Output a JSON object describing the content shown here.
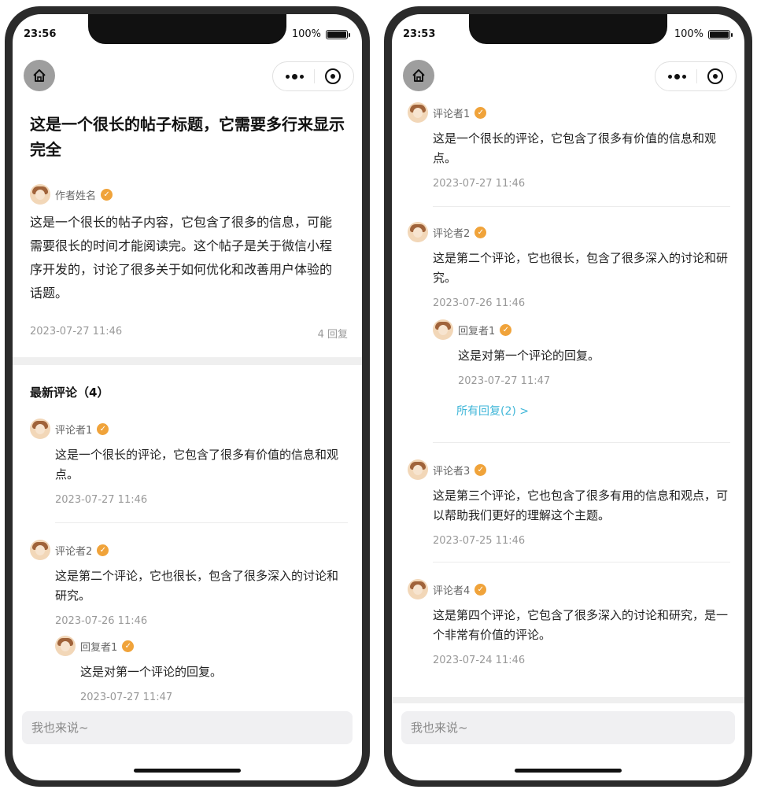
{
  "screens": {
    "left": {
      "time": "23:56",
      "battery": "100%",
      "post": {
        "title": "这是一个很长的帖子标题，它需要多行来显示完全",
        "author": "作者姓名",
        "content": "这是一个很长的帖子内容，它包含了很多的信息，可能需要很长的时间才能阅读完。这个帖子是关于微信小程序开发的，讨论了很多关于如何优化和改善用户体验的话题。",
        "date": "2023-07-27 11:46",
        "reply_count": "4 回复"
      },
      "section_title": "最新评论（4）",
      "comments": [
        {
          "name": "评论者1",
          "text": "这是一个很长的评论，它包含了很多有价值的信息和观点。",
          "time": "2023-07-27 11:46"
        },
        {
          "name": "评论者2",
          "text": "这是第二个评论，它也很长，包含了很多深入的讨论和研究。",
          "time": "2023-07-26 11:46"
        }
      ],
      "reply": {
        "name": "回复者1",
        "text": "这是对第一个评论的回复。",
        "time": "2023-07-27 11:47"
      },
      "input_placeholder": "我也来说~"
    },
    "right": {
      "time": "23:53",
      "battery": "100%",
      "comments": [
        {
          "name": "评论者1",
          "text": "这是一个很长的评论，它包含了很多有价值的信息和观点。",
          "time": "2023-07-27 11:46"
        },
        {
          "name": "评论者2",
          "text": "这是第二个评论，它也很长，包含了很多深入的讨论和研究。",
          "time": "2023-07-26 11:46"
        },
        {
          "name": "评论者3",
          "text": "这是第三个评论，它也包含了很多有用的信息和观点，可以帮助我们更好的理解这个主题。",
          "time": "2023-07-25 11:46"
        },
        {
          "name": "评论者4",
          "text": "这是第四个评论，它包含了很多深入的讨论和研究，是一个非常有价值的评论。",
          "time": "2023-07-24 11:46"
        }
      ],
      "reply": {
        "name": "回复者1",
        "text": "这是对第一个评论的回复。",
        "time": "2023-07-27 11:47"
      },
      "all_replies": "所有回复(2) >",
      "input_placeholder": "我也来说~"
    }
  },
  "icons": {
    "home": "home-icon",
    "more": "more-dots-icon",
    "close": "target-close-icon",
    "verified": "verified-badge-icon",
    "battery": "battery-icon"
  },
  "colors": {
    "accent_link": "#3fb6d8",
    "verified_badge": "#f0a33a",
    "meta_text": "#999999"
  }
}
